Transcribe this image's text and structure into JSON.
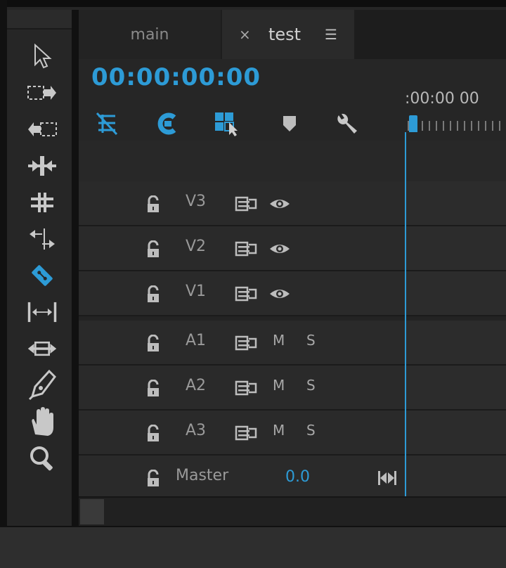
{
  "tools": [
    "selection",
    "track-select-forward",
    "track-select-backward",
    "ripple-edit",
    "rolling-edit",
    "rate-stretch",
    "razor",
    "slip",
    "slide",
    "pen",
    "hand",
    "zoom"
  ],
  "tabs": [
    {
      "label": "main"
    },
    {
      "label": "test",
      "close": "×",
      "menu": "☰"
    }
  ],
  "timecode": "00:00:00:00",
  "controls": [
    "snap-icon",
    "linked-selection-icon",
    "insert-overwrite-icon",
    "add-marker-icon",
    "settings-wrench-icon"
  ],
  "ruler": {
    "time": ":00:00   00"
  },
  "tracks": [
    {
      "label": "V3",
      "type": "video"
    },
    {
      "label": "V2",
      "type": "video"
    },
    {
      "label": "V1",
      "type": "video"
    },
    {
      "label": "A1",
      "type": "audio",
      "mute": "M",
      "solo": "S"
    },
    {
      "label": "A2",
      "type": "audio",
      "mute": "M",
      "solo": "S"
    },
    {
      "label": "A3",
      "type": "audio",
      "mute": "M",
      "solo": "S"
    }
  ],
  "master": {
    "label": "Master",
    "value": "0.0"
  },
  "colors": {
    "accent": "#2d9bd6",
    "panel": "#262626",
    "text": "#9a9a9a"
  }
}
